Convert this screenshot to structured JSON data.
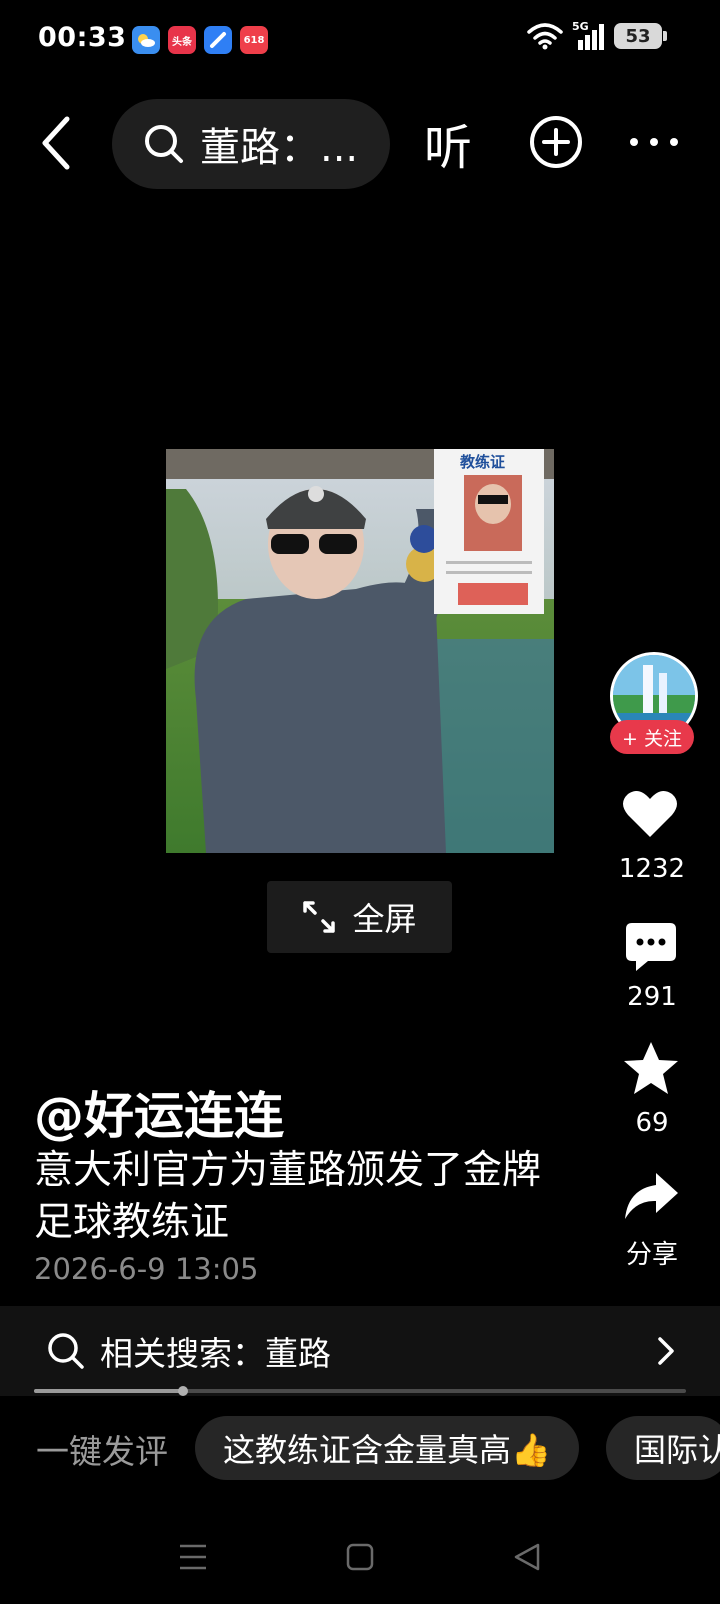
{
  "status_bar": {
    "time": "00:33",
    "apps": [
      {
        "name": "weather-app-icon",
        "color": "#3a8ef0",
        "label": ""
      },
      {
        "name": "toutiao-app-icon",
        "color": "#e8344a",
        "label": "头条"
      },
      {
        "name": "browser-app-icon",
        "color": "#2f7ff5",
        "label": ""
      },
      {
        "name": "618-app-icon",
        "color": "#ef3f4a",
        "label": "618"
      }
    ],
    "network": "5G",
    "battery": "53"
  },
  "top_nav": {
    "search_text": "董路：...",
    "listen_label": "听"
  },
  "video": {
    "overlay_title": "教练证"
  },
  "fullscreen_label": "全屏",
  "rail": {
    "follow_label": "+ 关注",
    "likes": "1232",
    "comments": "291",
    "favorites": "69",
    "share_label": "分享"
  },
  "post": {
    "author": "@好运连连",
    "caption": "意大利官方为董路颁发了金牌足球教练证",
    "date": "2026-6-9 13:05"
  },
  "related_search": {
    "label": "相关搜索：董路"
  },
  "quick_comment": {
    "label": "一键发评",
    "chips": [
      "这教练证含金量真高👍",
      "国际认"
    ]
  },
  "colors": {
    "background": "#000000",
    "follow_red": "#e8394b",
    "muted_text": "#8a8a8a"
  }
}
